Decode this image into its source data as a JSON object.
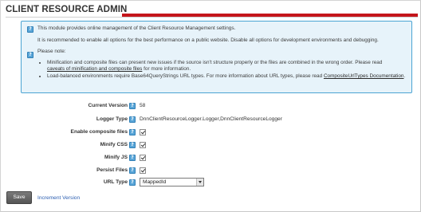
{
  "module": {
    "title": "CLIENT RESOURCE ADMIN"
  },
  "colors": {
    "accent_red": "#c4151b",
    "info_border": "#4ba4d3",
    "info_background": "#e7f3fa",
    "help_icon": "#5aa6d8",
    "save_button": "#666666"
  },
  "info": {
    "icon": "info-icon",
    "line1": "This module provides online management of the Client Resource Management settings.",
    "line2": "It is recommended to enable all options for the best performance on a public website. Disable all options for development environments and debugging.",
    "note_heading": "Please note:",
    "bullet1_text": "Minification and composite files can present new issues if the source isn't structure properly or the files are combined in the wrong order. Please read",
    "bullet1_link": "caveats of minification and composite files",
    "bullet1_after": "for more information.",
    "bullet2_text": "Load-balanced environments require Base64QueryStrings URL types. For more information about URL types, please read",
    "bullet2_link": "CompositeUrlTypes Documentation",
    "bullet2_after": "."
  },
  "fields": {
    "current_version": {
      "label": "Current Version",
      "value": "58"
    },
    "logger_type": {
      "label": "Logger Type",
      "value": "DnnClientResourceLogger.Logger,DnnClientResourceLogger"
    },
    "enable_composite": {
      "label": "Enable composite files",
      "checked": true
    },
    "minify_css": {
      "label": "Minify CSS",
      "checked": true
    },
    "minify_js": {
      "label": "Minify JS",
      "checked": true
    },
    "persist_files": {
      "label": "Persist Files",
      "checked": true
    },
    "url_type": {
      "label": "URL Type",
      "value": "MappedId"
    }
  },
  "actions": {
    "save": "Save",
    "increment_version": "Increment Version"
  }
}
